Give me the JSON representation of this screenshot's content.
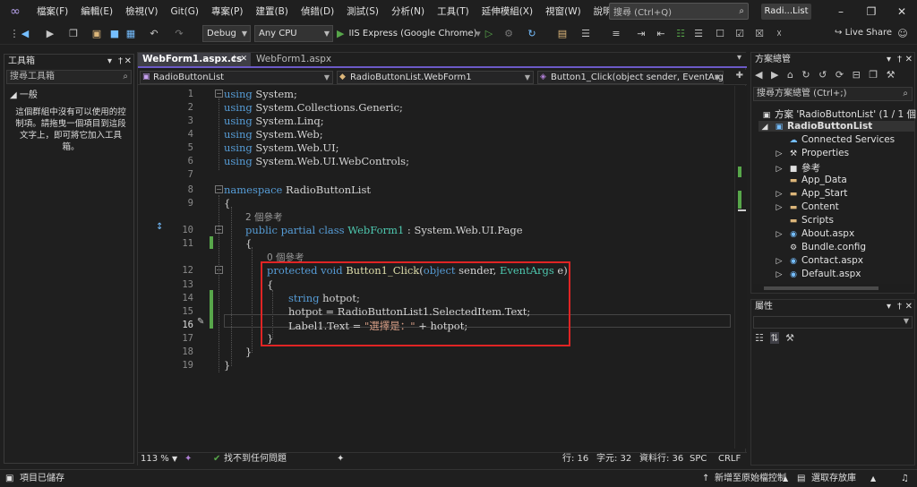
{
  "menu": [
    "檔案(F)",
    "編輯(E)",
    "檢視(V)",
    "Git(G)",
    "專案(P)",
    "建置(B)",
    "偵錯(D)",
    "測試(S)",
    "分析(N)",
    "工具(T)",
    "延伸模組(X)",
    "視窗(W)",
    "說明(H)"
  ],
  "search": {
    "placeholder": "搜尋 (Ctrl+Q)"
  },
  "window_title": "Radi...List",
  "toolbar": {
    "config": "Debug",
    "platform": "Any CPU",
    "run_label": "IIS Express (Google Chrome)",
    "live_share": "Live Share"
  },
  "toolbox": {
    "title": "工具箱",
    "search_placeholder": "搜尋工具箱",
    "group": "一般",
    "empty_text": "這個群組中沒有可以使用的控制項。請拖曳一個項目到這段文字上，即可將它加入工具箱。"
  },
  "editor": {
    "tabs": [
      "WebForm1.aspx.cs",
      "WebForm1.aspx"
    ],
    "nav": [
      "RadioButtonList",
      "RadioButtonList.WebForm1",
      "Button1_Click(object sender, EventArgs e)"
    ],
    "refs_class": "2 個參考",
    "refs_method": "0 個參考",
    "line_numbers": [
      "1",
      "2",
      "3",
      "4",
      "5",
      "6",
      "7",
      "8",
      "9",
      "10",
      "11",
      "12",
      "13",
      "14",
      "15",
      "16",
      "17",
      "18",
      "19"
    ],
    "code": {
      "l1": "System;",
      "l2": "System.Collections.Generic;",
      "l3": "System.Linq;",
      "l4": "System.Web;",
      "l5": "System.Web.UI;",
      "l6": "System.Web.UI.WebControls;",
      "using": "using",
      "ns_kw": "namespace",
      "ns_name": "RadioButtonList",
      "class_mods": "public partial class",
      "class_name": "WebForm1",
      "class_base": " : System.Web.UI.Page",
      "method_mods": "protected void",
      "method_name": "Button1_Click",
      "method_params_a": "(",
      "method_params_b": "object",
      "method_params_c": " sender, ",
      "method_params_d": "EventArgs",
      "method_params_e": " e)",
      "l14_kw": "string",
      "l14_rest": " hotpot;",
      "l15": "hotpot = RadioButtonList1.SelectedItem.Text;",
      "l16_a": "Label1.Text = ",
      "l16_str": "\"選擇是：\"",
      "l16_b": " + hotpot;",
      "open": "{",
      "close": "}"
    },
    "status": {
      "zoom": "113 %",
      "issues": "找不到任何問題",
      "line": "行: 16",
      "char": "字元: 32",
      "col": "資料行: 36",
      "spc": "SPC",
      "crlf": "CRLF"
    }
  },
  "solution": {
    "title": "方案總管",
    "search_placeholder": "搜尋方案總管 (Ctrl+;)",
    "solution_label": "方案 'RadioButtonList' (1 / 1 個",
    "project": "RadioButtonList",
    "items": [
      "Connected Services",
      "Properties",
      "參考",
      "App_Data",
      "App_Start",
      "Content",
      "Scripts",
      "About.aspx",
      "Bundle.config",
      "Contact.aspx",
      "Default.aspx"
    ]
  },
  "properties": {
    "title": "屬性"
  },
  "statusbar": {
    "left": "項目已儲存",
    "source_control": "新增至原始檔控制",
    "repo": "選取存放庫"
  },
  "colors": {
    "accent": "#6b59c7",
    "highlight": "#e02424",
    "added": "#57a64a"
  }
}
